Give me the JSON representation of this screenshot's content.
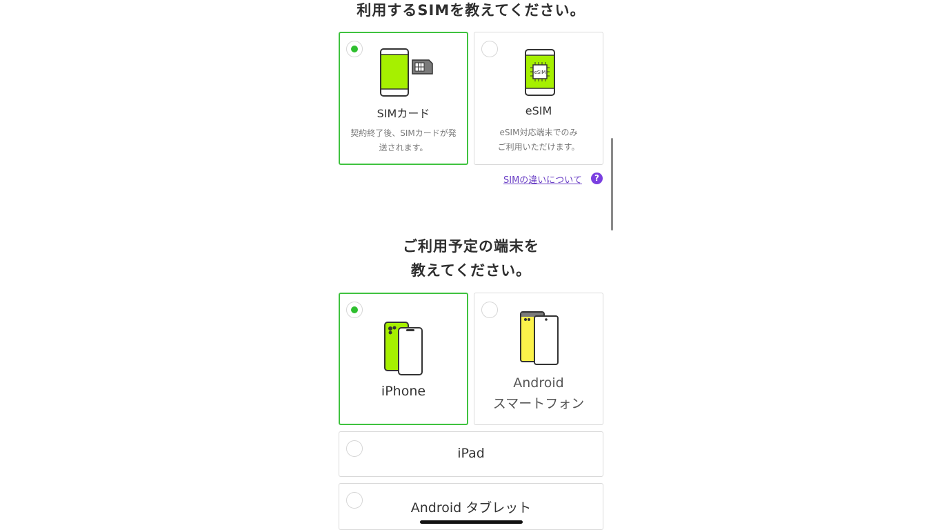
{
  "sim_section": {
    "heading": "利用するSIMを教えてください。",
    "options": [
      {
        "label": "SIMカード",
        "desc_line1": "契約終了後、SIMカードが発",
        "desc_line2": "送されます。",
        "selected": true
      },
      {
        "label": "eSIM",
        "desc_line1": "eSIM対応端末でのみ",
        "desc_line2": "ご利用いただけます。",
        "selected": false,
        "chip_text": "eSIM"
      }
    ],
    "help_link": "SIMの違いについて",
    "help_icon": "?"
  },
  "device_section": {
    "heading_line1": "ご利用予定の端末を",
    "heading_line2": "教えてください。",
    "options": [
      {
        "label": "iPhone",
        "selected": true
      },
      {
        "label_line1": "Android",
        "label_line2": "スマートフォン",
        "selected": false
      },
      {
        "label": "iPad",
        "selected": false
      },
      {
        "label": "Android タブレット",
        "selected": false
      }
    ]
  },
  "colors": {
    "accent_green": "#3fc23f",
    "phone_green": "#a6f000",
    "phone_yellow": "#fbf24a",
    "link_purple": "#6a3fc5"
  }
}
